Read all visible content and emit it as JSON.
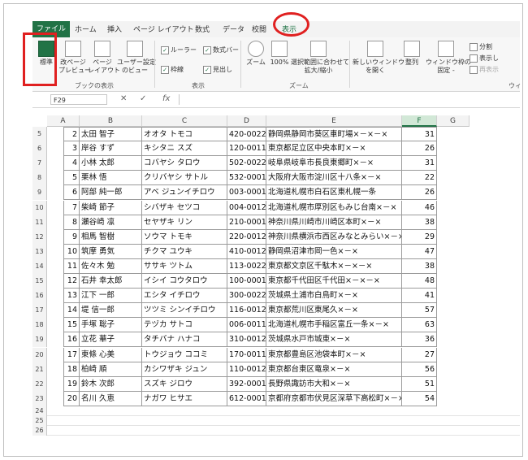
{
  "ribbon": {
    "tabs": [
      "ファイル",
      "ホーム",
      "挿入",
      "ページ レイアウト",
      "数式",
      "データ",
      "校閲",
      "表示"
    ],
    "buttons": {
      "normal": "標準",
      "page_preview_1": "改ページ",
      "page_preview_2": "プレビュー",
      "page_layout_1": "ページ",
      "page_layout_2": "レイアウト",
      "custom_view_1": "ユーザー設定",
      "custom_view_2": "のビュー",
      "zoom": "ズーム",
      "zoom100": "100%",
      "zoom_sel_1": "選択範囲に合わせて",
      "zoom_sel_2": "拡大/縮小",
      "new_window_1": "新しいウィンドウ",
      "new_window_2": "を開く",
      "arrange": "整列",
      "freeze_1": "ウィンドウ枠の",
      "freeze_2": "固定 -"
    },
    "checkboxes": {
      "ruler": "ルーラー",
      "formula_bar": "数式バー",
      "gridlines": "枠線",
      "headings": "見出し"
    },
    "right_items": [
      "分割",
      "表示し",
      "再表示"
    ],
    "groups": {
      "book_view": "ブックの表示",
      "show": "表示",
      "zoom": "ズーム",
      "window": "ウィ"
    }
  },
  "formula": {
    "name_box": "F29",
    "fx": "fx"
  },
  "columns": [
    "A",
    "B",
    "C",
    "D",
    "E",
    "F",
    "G"
  ],
  "rows": [
    {
      "r": "5",
      "no": "2",
      "name": "太田 智子",
      "kana": "オオタ トモコ",
      "zip": "420-0022",
      "addr": "静岡県静岡市葵区車町場×－×－×",
      "age": "31"
    },
    {
      "r": "6",
      "no": "3",
      "name": "岸谷 すず",
      "kana": "キシタニ スズ",
      "zip": "120-0011",
      "addr": "東京都足立区中央本町×－×",
      "age": "26"
    },
    {
      "r": "7",
      "no": "4",
      "name": "小林 太郎",
      "kana": "コバヤシ タロウ",
      "zip": "502-0022",
      "addr": "岐阜県岐阜市長良東郷町×－×",
      "age": "31"
    },
    {
      "r": "8",
      "no": "5",
      "name": "栗林 悟",
      "kana": "クリバヤシ サトル",
      "zip": "532-0001",
      "addr": "大阪府大阪市淀川区十八条×－×",
      "age": "22"
    },
    {
      "r": "9",
      "no": "6",
      "name": "阿部 純一郎",
      "kana": "アベ ジュンイチロウ",
      "zip": "003-0001",
      "addr": "北海道札幌市白石区東札幌一条",
      "age": "26"
    },
    {
      "r": "10",
      "no": "7",
      "name": "柴崎 節子",
      "kana": "シバザキ セツコ",
      "zip": "004-0012",
      "addr": "北海道札幌市厚別区もみじ台南×－×",
      "age": "46"
    },
    {
      "r": "11",
      "no": "8",
      "name": "瀬谷崎 凛",
      "kana": "セヤザキ リン",
      "zip": "210-0001",
      "addr": "神奈川県川崎市川崎区本町×－×",
      "age": "38"
    },
    {
      "r": "12",
      "no": "9",
      "name": "相馬 智樹",
      "kana": "ソウマ トモキ",
      "zip": "220-0012",
      "addr": "神奈川県横浜市西区みなとみらい×－×",
      "age": "29"
    },
    {
      "r": "13",
      "no": "10",
      "name": "筑摩 勇気",
      "kana": "チクマ ユウキ",
      "zip": "410-0012",
      "addr": "静岡県沼津市岡一色×－×",
      "age": "47"
    },
    {
      "r": "14",
      "no": "11",
      "name": "佐々木 勉",
      "kana": "ササキ ツトム",
      "zip": "113-0022",
      "addr": "東京都文京区千駄木×－×－×",
      "age": "38"
    },
    {
      "r": "15",
      "no": "12",
      "name": "石井 幸太郎",
      "kana": "イシイ コウタロウ",
      "zip": "100-0001",
      "addr": "東京都千代田区千代田×－×－×",
      "age": "48"
    },
    {
      "r": "16",
      "no": "13",
      "name": "江下 一郎",
      "kana": "エシタ イチロウ",
      "zip": "300-0022",
      "addr": "茨城県土浦市白鳥町×－×",
      "age": "41"
    },
    {
      "r": "17",
      "no": "14",
      "name": "堤 信一郎",
      "kana": "ツツミ シンイチロウ",
      "zip": "116-0012",
      "addr": "東京都荒川区東尾久×－×",
      "age": "57"
    },
    {
      "r": "18",
      "no": "15",
      "name": "手塚 聡子",
      "kana": "テヅカ サトコ",
      "zip": "006-0011",
      "addr": "北海道札幌市手稲区富丘一条×－×",
      "age": "63"
    },
    {
      "r": "19",
      "no": "16",
      "name": "立花 華子",
      "kana": "タチバナ ハナコ",
      "zip": "310-0012",
      "addr": "茨城県水戸市城東×－×",
      "age": "36"
    },
    {
      "r": "20",
      "no": "17",
      "name": "東條 心美",
      "kana": "トウジョウ ココミ",
      "zip": "170-0011",
      "addr": "東京都豊島区池袋本町×－×",
      "age": "27"
    },
    {
      "r": "21",
      "no": "18",
      "name": "柏崎 順",
      "kana": "カシワザキ ジュン",
      "zip": "110-0012",
      "addr": "東京都台東区竜泉×－×",
      "age": "56"
    },
    {
      "r": "22",
      "no": "19",
      "name": "鈴木 次郎",
      "kana": "スズキ ジロウ",
      "zip": "392-0001",
      "addr": "長野県諏訪市大和×－×",
      "age": "51"
    },
    {
      "r": "23",
      "no": "20",
      "name": "名川 久恵",
      "kana": "ナガワ ヒサエ",
      "zip": "612-0001",
      "addr": "京都府京都市伏見区深草下高松町×－×",
      "age": "54"
    }
  ],
  "empty_rows": [
    "24",
    "25",
    "26"
  ],
  "accent": "#217346",
  "highlight": "#e02020"
}
